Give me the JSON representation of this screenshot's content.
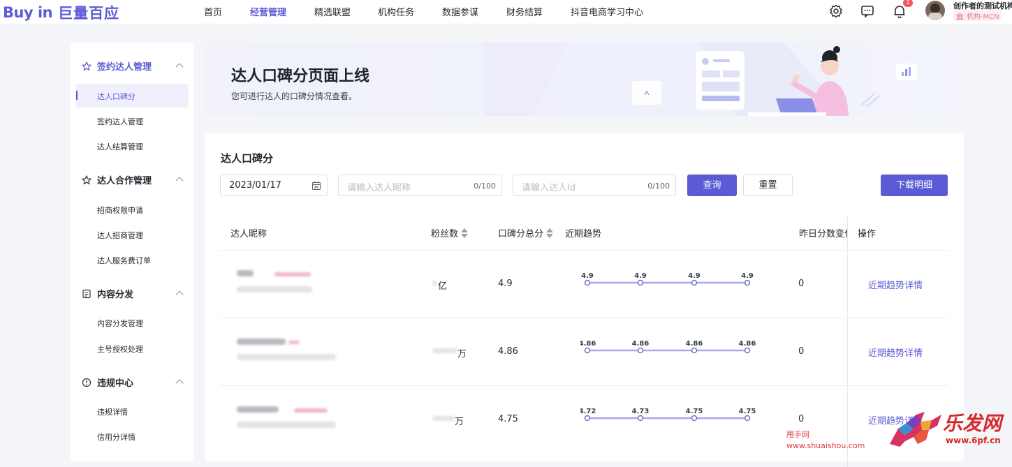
{
  "brand": {
    "logo_en": "Buy in",
    "logo_cn": "巨量百应"
  },
  "nav": [
    {
      "label": "首页",
      "active": false
    },
    {
      "label": "经营管理",
      "active": true
    },
    {
      "label": "精选联盟",
      "active": false
    },
    {
      "label": "机构任务",
      "active": false
    },
    {
      "label": "数据参谋",
      "active": false
    },
    {
      "label": "财务结算",
      "active": false
    },
    {
      "label": "抖音电商学习中心",
      "active": false
    }
  ],
  "header": {
    "notification_count": "1",
    "user_name": "创作者的测试机构",
    "user_role": "机构-MCN",
    "accent": "#5b5bd6"
  },
  "sidebar": {
    "groups": [
      {
        "label": "签约达人管理",
        "icon": "star-icon",
        "active": true,
        "items": [
          {
            "label": "达人口碑分",
            "active": true
          },
          {
            "label": "签约达人管理",
            "active": false
          },
          {
            "label": "达人结算管理",
            "active": false
          }
        ]
      },
      {
        "label": "达人合作管理",
        "icon": "star-outline-icon",
        "active": false,
        "items": [
          {
            "label": "招商权限申请",
            "active": false
          },
          {
            "label": "达人招商管理",
            "active": false
          },
          {
            "label": "达人服务费订单",
            "active": false
          }
        ]
      },
      {
        "label": "内容分发",
        "icon": "content-icon",
        "active": false,
        "items": [
          {
            "label": "内容分发管理",
            "active": false
          },
          {
            "label": "主号授权处理",
            "active": false
          }
        ]
      },
      {
        "label": "违规中心",
        "icon": "violation-icon",
        "active": false,
        "items": [
          {
            "label": "违规详情",
            "active": false
          },
          {
            "label": "信用分详情",
            "active": false
          }
        ]
      }
    ]
  },
  "banner": {
    "title": "达人口碑分页面上线",
    "subtitle": "您可进行达人的口碑分情况查看。"
  },
  "panel": {
    "title": "达人口碑分",
    "date_value": "2023/01/17",
    "nickname_placeholder": "请输入达人昵称",
    "nickname_count": "0/100",
    "id_placeholder": "请输入达人Id",
    "id_count": "0/100",
    "query_label": "查询",
    "reset_label": "重置",
    "download_label": "下载明细"
  },
  "table": {
    "columns": [
      "达人昵称",
      "粉丝数",
      "口碑分总分",
      "近期趋势",
      "昨日分数变化",
      "操作"
    ],
    "rows": [
      {
        "fans_suffix": "亿",
        "score": "4.9",
        "trend": [
          4.9,
          4.9,
          4.9,
          4.9
        ],
        "trend_labels": [
          "4.9",
          "4.9",
          "4.9",
          "4.9"
        ],
        "change": "0",
        "action": "近期趋势详情"
      },
      {
        "fans_suffix": "万",
        "score": "4.86",
        "trend": [
          4.86,
          4.86,
          4.86,
          4.86
        ],
        "trend_labels": [
          "4.86",
          "4.86",
          "4.86",
          "4.86"
        ],
        "change": "0",
        "action": "近期趋势详情"
      },
      {
        "fans_suffix": "万",
        "score": "4.75",
        "trend": [
          4.72,
          4.73,
          4.75,
          4.75
        ],
        "trend_labels": [
          "4.72",
          "4.73",
          "4.75",
          "4.75"
        ],
        "change": "0",
        "action": "近期趋势详情"
      }
    ]
  },
  "watermark": {
    "line1": "甩手网",
    "line2": "www.shuaishou.com",
    "brand": "乐发网",
    "site": "www.6pf.cn"
  }
}
